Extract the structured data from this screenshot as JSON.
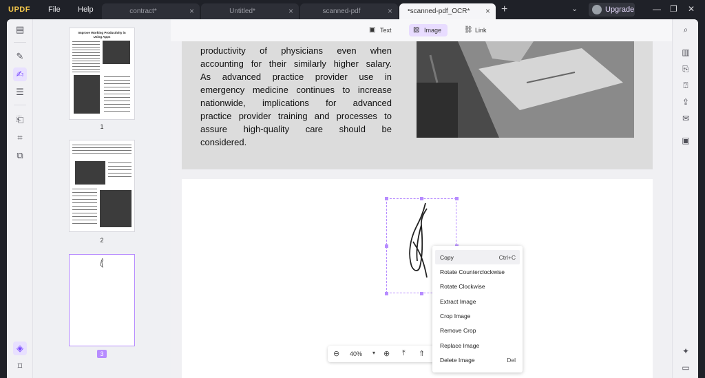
{
  "app": {
    "logo": "UPDF"
  },
  "menus": [
    "File",
    "Help"
  ],
  "tabs": [
    {
      "label": "contract*"
    },
    {
      "label": "Untitled*"
    },
    {
      "label": "scanned-pdf"
    },
    {
      "label": "scanned-pdf_OCR*"
    }
  ],
  "upgrade_label": "Upgrade",
  "modes": [
    {
      "label": "Text",
      "icon": "text-mode-icon"
    },
    {
      "label": "Image",
      "icon": "image-mode-icon"
    },
    {
      "label": "Link",
      "icon": "link-mode-icon"
    }
  ],
  "page_text": [
    "productivity of physicians even when",
    "accounting for their similarly higher salary.",
    "As advanced practice provider use in",
    "emergency medicine continues to increase",
    "nationwide, implications for advanced",
    "practice provider training and processes to",
    "assure high-quality care should be",
    "considered."
  ],
  "thumbnails": [
    {
      "page": "1",
      "title": "Improve Working Productivity in Using Apps"
    },
    {
      "page": "2"
    },
    {
      "page": "3"
    }
  ],
  "context_menu": [
    {
      "label": "Copy",
      "shortcut": "Ctrl+C"
    },
    {
      "label": "Rotate Counterclockwise"
    },
    {
      "label": "Rotate Clockwise"
    },
    {
      "label": "Extract Image"
    },
    {
      "label": "Crop Image"
    },
    {
      "label": "Remove Crop"
    },
    {
      "label": "Replace Image"
    },
    {
      "label": "Delete Image",
      "shortcut": "Del"
    }
  ],
  "zoom": {
    "level": "40%"
  },
  "colors": {
    "accent": "#b78cff",
    "titlebar": "#1f2128"
  }
}
